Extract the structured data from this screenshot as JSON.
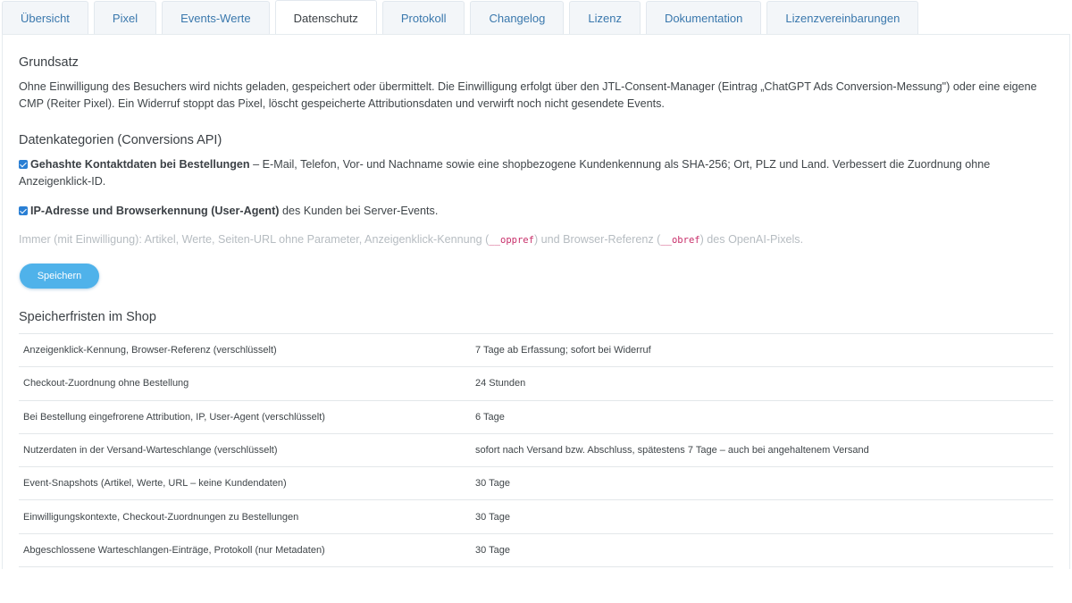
{
  "tabs": [
    {
      "label": "Übersicht"
    },
    {
      "label": "Pixel"
    },
    {
      "label": "Events-Werte"
    },
    {
      "label": "Datenschutz",
      "active": true
    },
    {
      "label": "Protokoll"
    },
    {
      "label": "Changelog"
    },
    {
      "label": "Lizenz"
    },
    {
      "label": "Dokumentation"
    },
    {
      "label": "Lizenzvereinbarungen"
    }
  ],
  "principle": {
    "heading": "Grundsatz",
    "text": "Ohne Einwilligung des Besuchers wird nichts geladen, gespeichert oder übermittelt. Die Einwilligung erfolgt über den JTL-Consent-Manager (Eintrag „ChatGPT Ads Conversion-Messung\") oder eine eigene CMP (Reiter Pixel). Ein Widerruf stoppt das Pixel, löscht gespeicherte Attributionsdaten und verwirft noch nicht gesendete Events."
  },
  "categories": {
    "heading": "Datenkategorien (Conversions API)",
    "contact": {
      "checked": true,
      "label": "Gehashte Kontaktdaten bei Bestellungen",
      "text": " – E-Mail, Telefon, Vor- und Nachname sowie eine shopbezogene Kundenkennung als SHA-256; Ort, PLZ und Land. Verbessert die Zuordnung ohne Anzeigenklick-ID."
    },
    "ip": {
      "checked": true,
      "label": "IP-Adresse und Browserkennung (User-Agent)",
      "text": " des Kunden bei Server-Events."
    },
    "always": {
      "prefix": "Immer (mit Einwilligung): Artikel, Werte, Seiten-URL ohne Parameter, Anzeigenklick-Kennung (",
      "code1": "__oppref",
      "middle": ") und Browser-Referenz (",
      "code2": "__obref",
      "suffix": ") des OpenAI-Pixels."
    },
    "save_label": "Speichern"
  },
  "retention": {
    "heading": "Speicherfristen im Shop",
    "rows": [
      {
        "item": "Anzeigenklick-Kennung, Browser-Referenz (verschlüsselt)",
        "period": "7 Tage ab Erfassung; sofort bei Widerruf"
      },
      {
        "item": "Checkout-Zuordnung ohne Bestellung",
        "period": "24 Stunden"
      },
      {
        "item": "Bei Bestellung eingefrorene Attribution, IP, User-Agent (verschlüsselt)",
        "period": "6 Tage"
      },
      {
        "item": "Nutzerdaten in der Versand-Warteschlange (verschlüsselt)",
        "period": "sofort nach Versand bzw. Abschluss, spätestens 7 Tage – auch bei angehaltenem Versand"
      },
      {
        "item": "Event-Snapshots (Artikel, Werte, URL – keine Kundendaten)",
        "period": "30 Tage"
      },
      {
        "item": "Einwilligungskontexte, Checkout-Zuordnungen zu Bestellungen",
        "period": "30 Tage"
      },
      {
        "item": "Abgeschlossene Warteschlangen-Einträge, Protokoll (nur Metadaten)",
        "period": "30 Tage"
      }
    ]
  },
  "colors": {
    "accent": "#4fb2ea",
    "link": "#3a78ad",
    "checkbox": "#2a7fd4",
    "code": "#c82f6a"
  }
}
